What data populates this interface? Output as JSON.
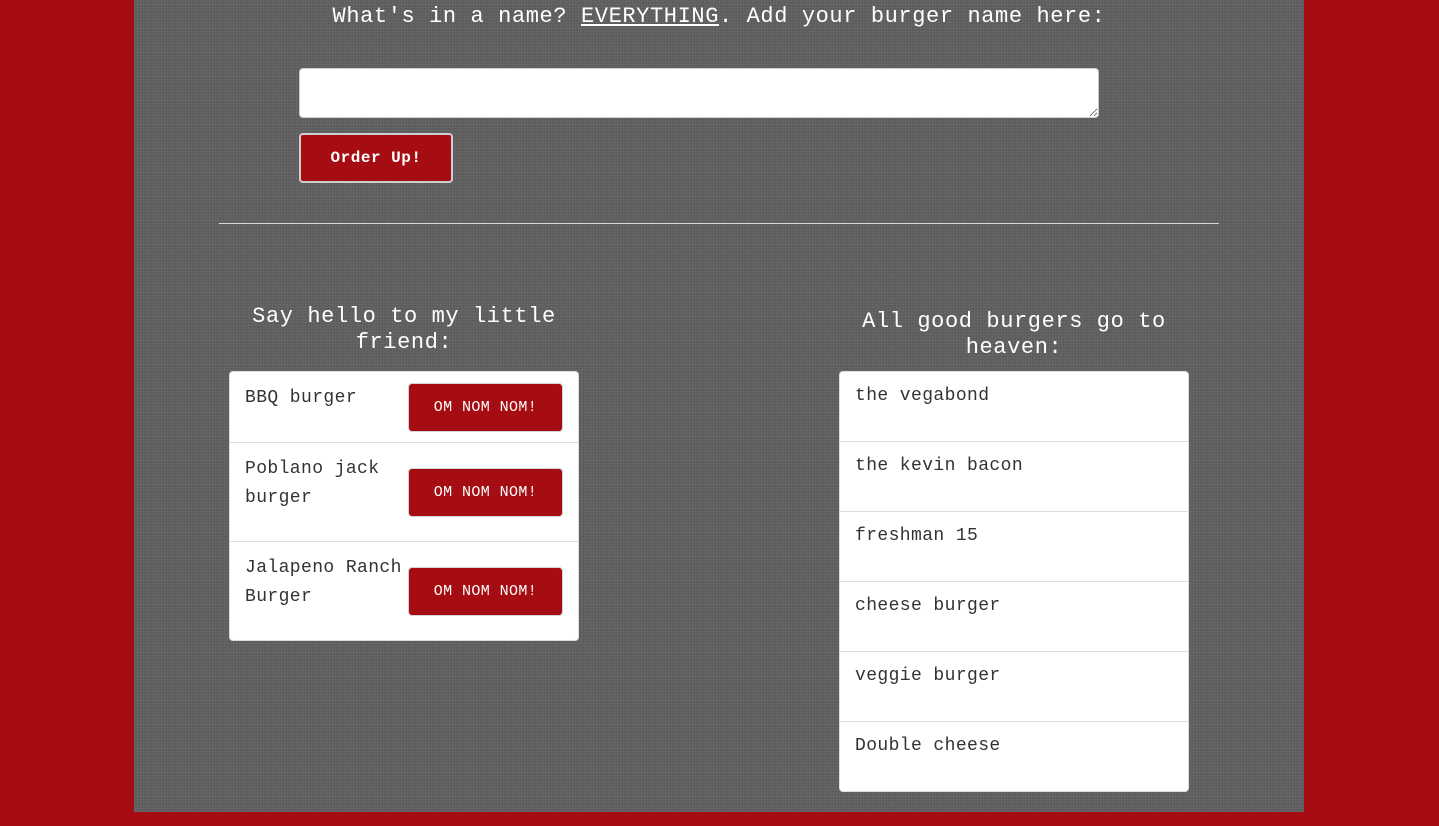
{
  "form": {
    "prompt_before": "What's in a name? ",
    "prompt_emph": "EVERYTHING",
    "prompt_after": ". Add your burger name here:",
    "input_value": "",
    "submit_label": "Order Up!"
  },
  "to_eat": {
    "title": "Say hello to my little friend:",
    "button_label": "OM NOM NOM!",
    "items": [
      {
        "name": "BBQ burger"
      },
      {
        "name": "Poblano jack burger"
      },
      {
        "name": "Jalapeno Ranch Burger"
      }
    ]
  },
  "eaten": {
    "title": "All good burgers go to heaven:",
    "items": [
      {
        "name": "the vegabond"
      },
      {
        "name": "the kevin bacon"
      },
      {
        "name": "freshman 15"
      },
      {
        "name": "cheese burger"
      },
      {
        "name": "veggie burger"
      },
      {
        "name": "Double cheese"
      }
    ]
  },
  "colors": {
    "brand_red": "#a50d12",
    "panel_gray": "#5e5e5e"
  }
}
